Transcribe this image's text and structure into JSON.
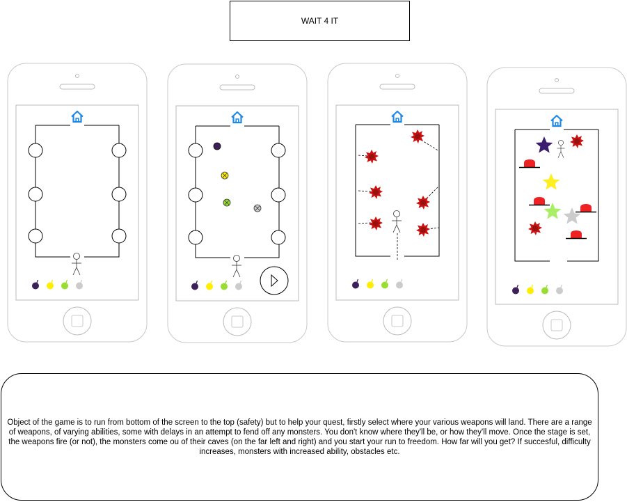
{
  "title": "WAIT 4 IT",
  "description": "Object of the game is to run from bottom of the screen to the top (safety) but to help your quest, firstly select where your various weapons will land. There are a range of weapons, of varying abilities, some with delays in an attempt to fend off any monsters. You don't know where they'll be, or how they'll move. Once the stage is set, the weapons fire (or not), the monsters come ou of their caves (on the far left and right) and you start your run to freedom. How far will you get? If succesful, difficulty increases, monsters with increased ability, obstacles etc.",
  "colors": {
    "home_icon": "#1E88E5",
    "bomb_purple": "#3B2157",
    "bomb_yellow": "#FFEE00",
    "bomb_green": "#99DD33",
    "bomb_grey": "#CCCCCC",
    "monster_red": "#CC1111",
    "star_purple": "#3B1F6E",
    "star_yellow": "#FFEE22",
    "star_green": "#AAEE66",
    "star_grey": "#CCCCCC",
    "shelter_red": "#EE2222"
  },
  "screens": [
    {
      "name": "stage-select",
      "elements": [
        "home-icon",
        "cave-circles",
        "runner",
        "weapon-tray"
      ]
    },
    {
      "name": "weapon-placement",
      "elements": [
        "home-icon",
        "cave-circles",
        "placed-weapons",
        "runner",
        "weapon-tray",
        "play-button"
      ]
    },
    {
      "name": "monsters-emerge",
      "elements": [
        "home-icon",
        "monsters",
        "runner",
        "weapon-tray"
      ]
    },
    {
      "name": "obstacles-level",
      "elements": [
        "home-icon",
        "stars",
        "monsters",
        "shelters",
        "runner",
        "weapon-tray"
      ]
    }
  ]
}
